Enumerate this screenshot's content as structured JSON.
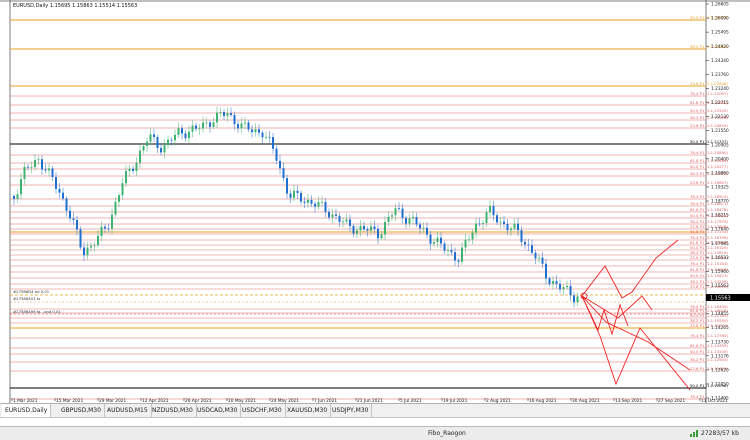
{
  "header": {
    "symbol": "EURUSD,Daily",
    "ohlc": "1.15695 1.15863 1.15514 1.15563"
  },
  "price_axis": [
    "1.26605",
    "1.26090",
    "1.25495",
    "1.24920",
    "1.24340",
    "1.23760",
    "1.23240",
    "1.22715",
    "1.22130",
    "1.21550",
    "1.20905",
    "1.20400",
    "1.19860",
    "1.19325",
    "1.18770",
    "1.18215",
    "1.17640",
    "1.17085",
    "1.16533",
    "1.15960",
    "1.15563",
    "1.15415",
    "1.14855",
    "1.14265",
    "1.13730",
    "1.13176",
    "1.12620",
    "1.12050",
    "1.11495"
  ],
  "current_price": "1.15563",
  "time_axis": [
    "1 Mar 2021",
    "15 Mar 2021",
    "29 Mar 2021",
    "12 Apr 2021",
    "26 Apr 2021",
    "10 May 2021",
    "24 May 2021",
    "7 Jun 2021",
    "21 Jun 2021",
    "5 Jul 2021",
    "19 Jul 2021",
    "2 Aug 2021",
    "16 Aug 2021",
    "30 Aug 2021",
    "13 Sep 2021",
    "27 Sep 2021",
    "11 Oct 2021"
  ],
  "fib_labels": {
    "group1": [
      "50.0 P1 (1.1.26033)",
      "38.2 P1 (1.1.24807)",
      "23.6 P1 (1.1.22848)"
    ],
    "group2": [
      "76.4 P1 (1.1.22097)",
      "61.8 P1 (1.1.21860)",
      "50.0 P1 (1.1.21545)",
      "38.2 P1 (1.1.21228)",
      "23.6 P1 (1.1.20834)"
    ],
    "group3": [
      "50.0 P1 (1.1.21337)"
    ],
    "group4": [
      "76.4 P1 (1.1.20890)",
      "61.8 P1 (1.1.20484)",
      "50.0 P1 (1.1.20277)",
      "38.2 P1 (1.1.19970)",
      "23.6 P1 (1.1.19607)"
    ],
    "group5": [
      "76.4 P1 (1.1.18974)",
      "76.4 P1 (1.1.18671)",
      "61.8 P1 (1.1.18478)",
      "50.0 P1 (1.1.18225)",
      "38.2 P1 (1.1.17975)",
      "23.6 P1 (1.1.17606)",
      "61.8 P1 (1.1.17234)"
    ],
    "group6": [
      "76.4 P1 (1.1.16795)",
      "61.8 P1 (1.1.16406)",
      "50.0 P1 (1.1.16120)",
      "38.2 P1 (1.1.15819)",
      "23.6 P1 (1.1.15502)",
      "76.4 P1 (1.1.15154)",
      "61.8 P1 (1.1.14826)",
      "50.0 P1 (1.1.14527)",
      "38.2 P1 (1.1.14239)",
      "23.6 P1 (1.1.13870)"
    ],
    "group7": [
      "76.4 P1 (1.1.16445)",
      "61.8 P1 (1.1.16026)",
      "50.0 P1 (1.1.15763)",
      "38.2 P1 (1.1.15550)",
      "23.6 P1 (1.1.15277)"
    ],
    "group8": [
      "76.4 P1 (1.1.13765)",
      "61.8 P1 (1.1.13459)",
      "50.0 P1 (1.1.13205)",
      "38.2 P1 (1.1.12944)",
      "23.6 P1 (1.1.12625)"
    ],
    "group9": [
      "50.0 P1 (1.1.12096)"
    ],
    "group10": [
      "76.4 P1 ("
    ]
  },
  "left_labels": [
    "#27586D4 ed 0.01",
    "#27586403 ts",
    "#27586499 fa. .und 0.01"
  ],
  "tabs": [
    "EURUSD,Daily",
    "GBPUSD,M30",
    "AUDUSD,M15",
    "NZDUSD,M30",
    "USDCAD,M30",
    "USDCHF,M30",
    "XAUUSD,M30",
    "USDJPY,M30"
  ],
  "status": {
    "profile": "Fibo_Raogon",
    "traffic": "27283/57 kb"
  },
  "colors": {
    "bull": "#3cb371",
    "bear": "#1e6fd0",
    "fib_orange": "#e8a020",
    "fib_red": "#e06060",
    "zigzag": "#ee2222",
    "black": "#000000"
  }
}
